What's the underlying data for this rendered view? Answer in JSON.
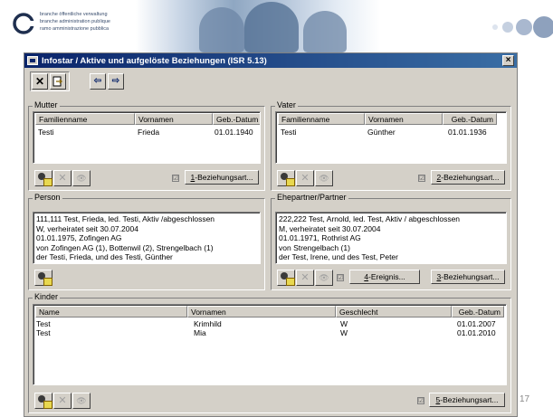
{
  "banner": {
    "org_lines": [
      "branche öffentliche verwaltung",
      "branche administration publique",
      "ramo amministrazione pubblica"
    ]
  },
  "page_number": "17",
  "window": {
    "title": "Infostar / Aktive und aufgelöste Beziehungen (ISR 5.13)",
    "close_glyph": "×",
    "toolbar": {
      "cancel_glyph": "✕",
      "back_glyph": "⇦",
      "forward_glyph": "⇨"
    }
  },
  "mutter": {
    "label": "Mutter",
    "columns": [
      "Familienname",
      "Vornamen",
      "Geb.-Datum"
    ],
    "rows": [
      [
        "Testi",
        "Frieda",
        "01.01.1940"
      ]
    ],
    "check": "☑",
    "beziehungsart": {
      "accel": "1",
      "label": "-Beziehungsart..."
    }
  },
  "vater": {
    "label": "Vater",
    "columns": [
      "Familienname",
      "Vornamen",
      "Geb.-Datum"
    ],
    "rows": [
      [
        "Testi",
        "Günther",
        "01.01.1936"
      ]
    ],
    "check": "☑",
    "beziehungsart": {
      "accel": "2",
      "label": "-Beziehungsart..."
    }
  },
  "person": {
    "label": "Person",
    "lines": [
      "111,111 Test, Frieda, led. Testi, Aktiv /abgeschlossen",
      "W, verheiratet seit 30.07.2004",
      "01.01.1975, Zofingen AG",
      "von Zofingen AG (1), Bottenwil (2), Strengelbach (1)",
      "der Testi, Frieda, und des Testi, Günther"
    ]
  },
  "partner": {
    "label": "Ehepartner/Partner",
    "lines": [
      "222,222 Test, Arnold, led. Test, Aktiv / abgeschlossen",
      "M, verheiratet seit 30.07.2004",
      "01.01.1971, Rothrist AG",
      "von  Strengelbach (1)",
      "der Test, Irene, und des Test, Peter"
    ],
    "check": "☑",
    "ereignis": {
      "accel": "4",
      "label": "-Ereignis..."
    },
    "beziehungsart": {
      "accel": "3",
      "label": "-Beziehungsart..."
    }
  },
  "kinder": {
    "label": "Kinder",
    "columns": [
      "Name",
      "Vornamen",
      "Geschlecht",
      "Geb.-Datum"
    ],
    "rows": [
      [
        "Test",
        "Krimhild",
        "W",
        "01.01.2007"
      ],
      [
        "Test",
        "Mia",
        "W",
        "01.01.2010"
      ]
    ],
    "check": "☑",
    "beziehungsart": {
      "accel": "5",
      "label": "-Beziehungsart..."
    }
  },
  "icons": {
    "disabled_delete": "✕",
    "disabled_search": "👁"
  }
}
